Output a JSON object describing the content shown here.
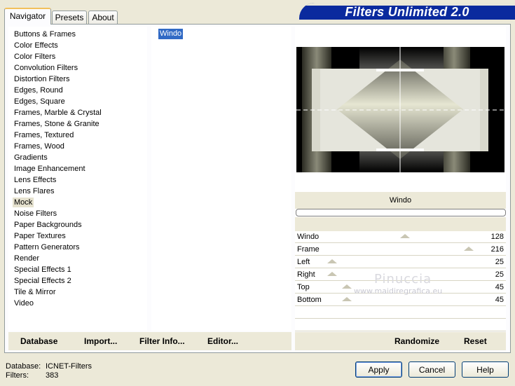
{
  "tabs": [
    {
      "label": "Navigator",
      "active": true
    },
    {
      "label": "Presets",
      "active": false
    },
    {
      "label": "About",
      "active": false
    }
  ],
  "header": {
    "title": "Filters Unlimited 2.0"
  },
  "categories": [
    "Buttons & Frames",
    "Color Effects",
    "Color Filters",
    "Convolution Filters",
    "Distortion Filters",
    "Edges, Round",
    "Edges, Square",
    "Frames, Marble & Crystal",
    "Frames, Stone & Granite",
    "Frames, Textured",
    "Frames, Wood",
    "Gradients",
    "Image Enhancement",
    "Lens Effects",
    "Lens Flares",
    "Mock",
    "Noise Filters",
    "Paper Backgrounds",
    "Paper Textures",
    "Pattern Generators",
    "Render",
    "Special Effects 1",
    "Special Effects 2",
    "Tile & Mirror",
    "Video"
  ],
  "selected_category": "Mock",
  "filters": [
    "Windo"
  ],
  "selected_filter": "Windo",
  "preview": {
    "filter_name": "Windo"
  },
  "params": [
    {
      "label": "Windo",
      "value": "128",
      "level": 0.5
    },
    {
      "label": "Frame",
      "value": "216",
      "level": 0.85
    },
    {
      "label": "Left",
      "value": "25",
      "level": 0.1
    },
    {
      "label": "Right",
      "value": "25",
      "level": 0.1
    },
    {
      "label": "Top",
      "value": "45",
      "level": 0.18
    },
    {
      "label": "Bottom",
      "value": "45",
      "level": 0.18
    }
  ],
  "left_toolbar": {
    "database": "Database",
    "import": "Import...",
    "filter_info": "Filter Info...",
    "editor": "Editor..."
  },
  "right_toolbar": {
    "randomize": "Randomize",
    "reset": "Reset"
  },
  "status": {
    "database_label": "Database:",
    "database_value": "ICNET-Filters",
    "filters_label": "Filters:",
    "filters_value": "383"
  },
  "buttons": {
    "apply": "Apply",
    "cancel": "Cancel",
    "help": "Help"
  },
  "watermark": {
    "line1": "Pinuccia",
    "line2": "www.maidiregrafica.eu"
  }
}
